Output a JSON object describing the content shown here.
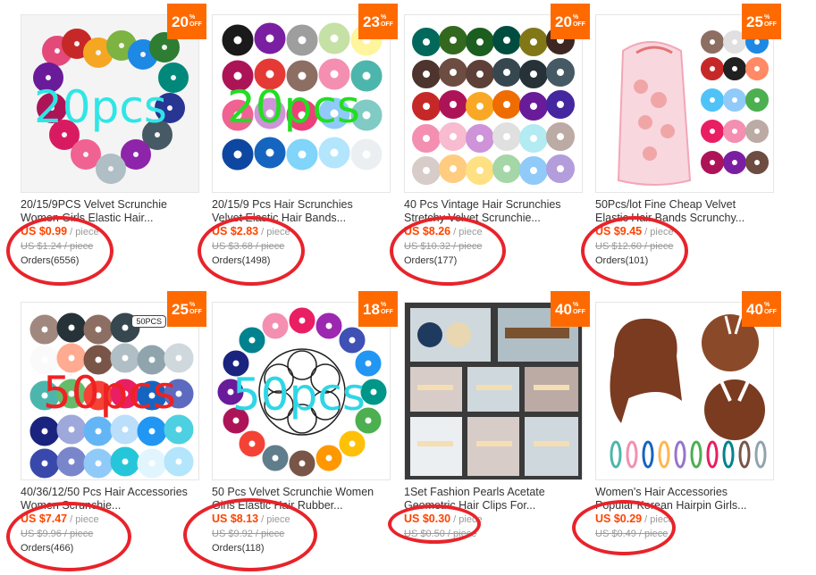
{
  "products": [
    {
      "title_line1": "20/15/9PCS Velvet Scrunchie",
      "title_line2": "Women Girls Elastic Hair...",
      "price": "US $0.99",
      "unit": " / piece",
      "original_price": "US $1.24 / piece",
      "orders": "Orders(6556)",
      "discount": "20",
      "discount_pct": "%",
      "discount_off": "OFF",
      "overlay_text": "20pcs",
      "overlay_color": "#2fe6e6"
    },
    {
      "title_line1": "20/15/9 Pcs Hair Scrunchies",
      "title_line2": "Velvet Elastic Hair Bands...",
      "price": "US $2.83",
      "unit": " / piece",
      "original_price": "US $3.68 / piece",
      "orders": "Orders(1498)",
      "discount": "23",
      "discount_pct": "%",
      "discount_off": "OFF",
      "overlay_text": "20pcs",
      "overlay_color": "#22dd22"
    },
    {
      "title_line1": "40 Pcs Vintage Hair Scrunchies",
      "title_line2": "Stretchy Velvet Scrunchie...",
      "price": "US $8.26",
      "unit": " / piece",
      "original_price": "US $10.32 / piece",
      "orders": "Orders(177)",
      "discount": "20",
      "discount_pct": "%",
      "discount_off": "OFF"
    },
    {
      "title_line1": "50Pcs/lot Fine Cheap Velvet",
      "title_line2": "Elastic Hair Bands Scrunchy...",
      "price": "US $9.45",
      "unit": " / piece",
      "original_price": "US $12.60 / piece",
      "orders": "Orders(101)",
      "discount": "25",
      "discount_pct": "%",
      "discount_off": "OFF"
    },
    {
      "title_line1": "40/36/12/50 Pcs Hair Accessories",
      "title_line2": "Women Scrunchie...",
      "price": "US $7.47",
      "unit": " / piece",
      "original_price": "US $9.96 / piece",
      "orders": "Orders(466)",
      "discount": "25",
      "discount_pct": "%",
      "discount_off": "OFF",
      "overlay_text": "50pcs",
      "overlay_color": "#ee2222",
      "tag": "50PCS"
    },
    {
      "title_line1": "50 Pcs Velvet Scrunchie Women",
      "title_line2": "Girls Elastic Hair Rubber...",
      "price": "US $8.13",
      "unit": " / piece",
      "original_price": "US $9.92 / piece",
      "orders": "Orders(118)",
      "discount": "18",
      "discount_pct": "%",
      "discount_off": "OFF",
      "overlay_text": "50pcs",
      "overlay_color": "#2fd6e6"
    },
    {
      "title_line1": "1Set Fashion Pearls Acetate",
      "title_line2": "Geometric Hair Clips For...",
      "price": "US $0.30",
      "unit": " / piece",
      "original_price": "US $0.50 / piece",
      "discount": "40",
      "discount_pct": "%",
      "discount_off": "OFF"
    },
    {
      "title_line1": "Women's Hair Accessories",
      "title_line2": "Popular Korean Hairpin Girls...",
      "price": "US $0.29",
      "unit": " / piece",
      "original_price": "US $0.49 / piece",
      "discount": "40",
      "discount_pct": "%",
      "discount_off": "OFF"
    }
  ],
  "colors": {
    "accent": "#ff6a00",
    "price": "#ff4400",
    "annotation_circle": "#e8232a"
  }
}
